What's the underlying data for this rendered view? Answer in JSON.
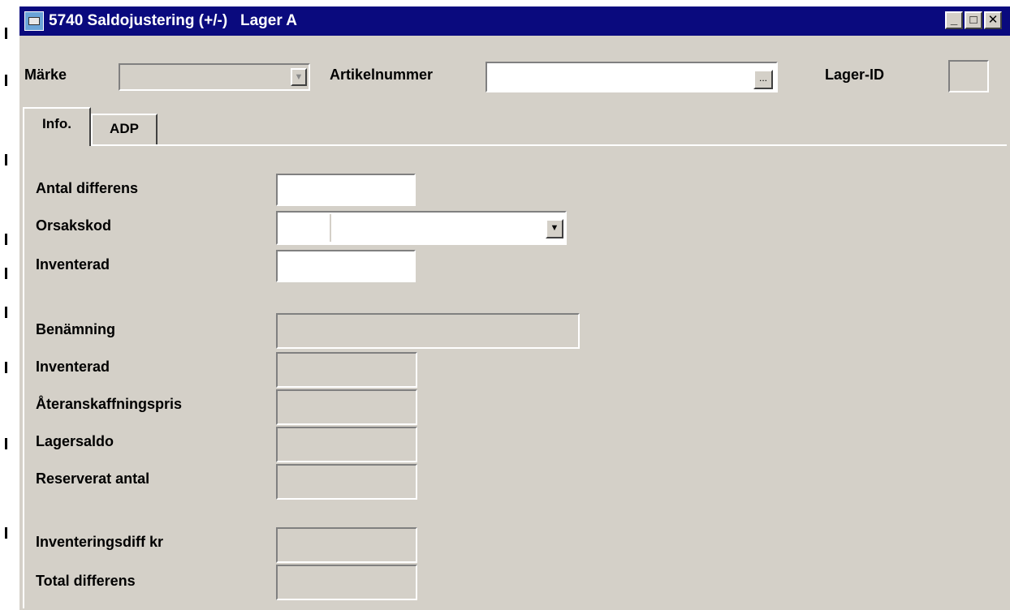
{
  "window": {
    "title": "5740 Saldojustering (+/-)   Lager A",
    "controls": {
      "minimize": "_",
      "maximize": "□",
      "close": "✕"
    },
    "icon": "app-icon"
  },
  "header": {
    "marke_label": "Märke",
    "marke_value": "",
    "artikel_label": "Artikelnummer",
    "artikel_value": "",
    "browse_button": "...",
    "lager_id_label": "Lager-ID",
    "lager_id_value": ""
  },
  "tabs": [
    {
      "label": "Info.",
      "active": true
    },
    {
      "label": "ADP",
      "active": false
    }
  ],
  "form": {
    "antal_differens": {
      "label": "Antal differens",
      "value": ""
    },
    "orsakskod": {
      "label": "Orsakskod",
      "code": "",
      "description": ""
    },
    "inventerad_input": {
      "label": "Inventerad",
      "value": ""
    },
    "benamning": {
      "label": "Benämning",
      "value": ""
    },
    "inventerad_ro": {
      "label": "Inventerad",
      "value": ""
    },
    "ateranskaffningspris": {
      "label": "Återanskaffningspris",
      "value": ""
    },
    "lagersaldo": {
      "label": "Lagersaldo",
      "value": ""
    },
    "reserverat_antal": {
      "label": "Reserverat antal",
      "value": ""
    },
    "inventeringsdiff_kr": {
      "label": "Inventeringsdiff kr",
      "value": ""
    },
    "total_differens": {
      "label": "Total differens",
      "value": ""
    }
  },
  "icons": {
    "dropdown": "chevron-down-icon"
  },
  "colors": {
    "titlebar": "#0a0a7e",
    "window_bg": "#d4d0c8"
  }
}
